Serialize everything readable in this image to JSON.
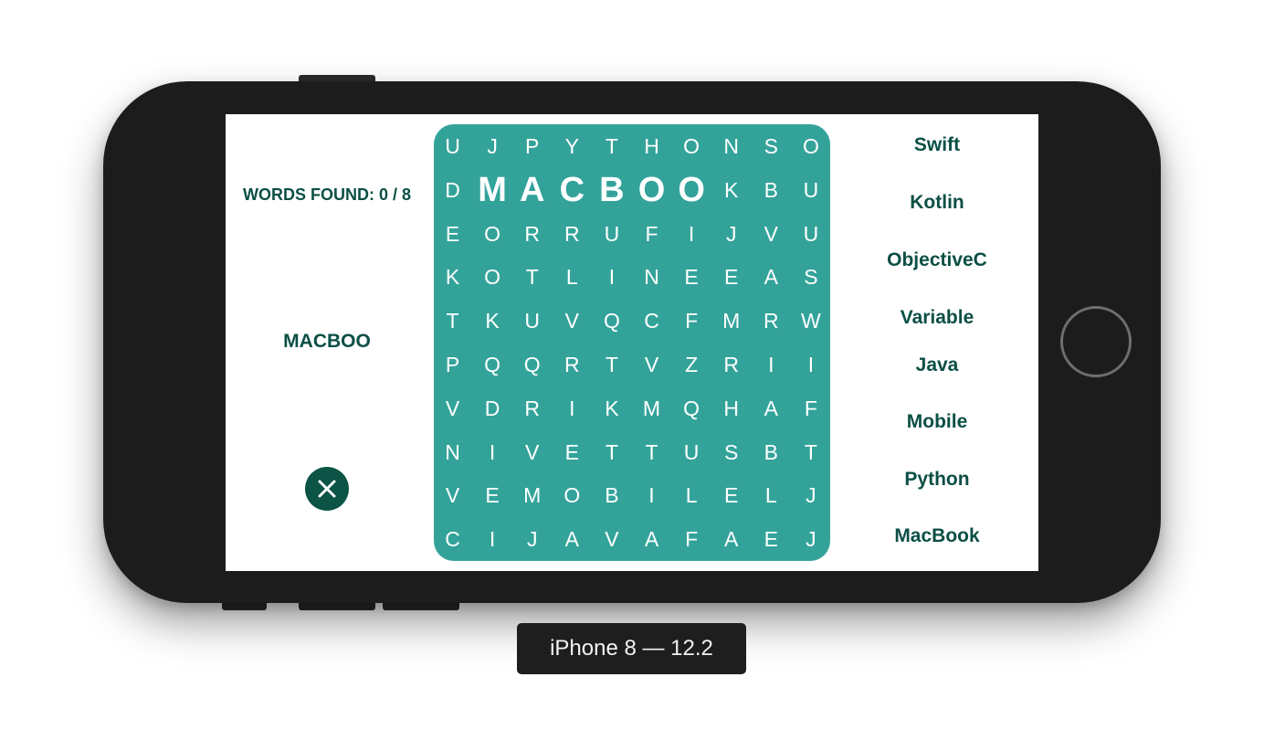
{
  "game": {
    "words_found": "WORDS FOUND: 0 / 8",
    "current_selection": "MACBOO",
    "close_icon": "close-icon"
  },
  "grid": {
    "rows": [
      [
        "U",
        "J",
        "P",
        "Y",
        "T",
        "H",
        "O",
        "N",
        "S",
        "O"
      ],
      [
        "D",
        "M",
        "A",
        "C",
        "B",
        "O",
        "O",
        "K",
        "B",
        "U"
      ],
      [
        "E",
        "O",
        "R",
        "R",
        "U",
        "F",
        "I",
        "J",
        "V",
        "U"
      ],
      [
        "K",
        "O",
        "T",
        "L",
        "I",
        "N",
        "E",
        "E",
        "A",
        "S"
      ],
      [
        "T",
        "K",
        "U",
        "V",
        "Q",
        "C",
        "F",
        "M",
        "R",
        "W"
      ],
      [
        "P",
        "Q",
        "Q",
        "R",
        "T",
        "V",
        "Z",
        "R",
        "I",
        "I"
      ],
      [
        "V",
        "D",
        "R",
        "I",
        "K",
        "M",
        "Q",
        "H",
        "A",
        "F"
      ],
      [
        "N",
        "I",
        "V",
        "E",
        "T",
        "T",
        "U",
        "S",
        "B",
        "T"
      ],
      [
        "V",
        "E",
        "M",
        "O",
        "B",
        "I",
        "L",
        "E",
        "L",
        "J"
      ],
      [
        "C",
        "I",
        "J",
        "A",
        "V",
        "A",
        "F",
        "A",
        "E",
        "J"
      ]
    ],
    "selected_cells": [
      [
        1,
        1
      ],
      [
        1,
        2
      ],
      [
        1,
        3
      ],
      [
        1,
        4
      ],
      [
        1,
        5
      ],
      [
        1,
        6
      ]
    ],
    "color": "#33a39a"
  },
  "word_list": [
    "Swift",
    "Kotlin",
    "ObjectiveC",
    "Variable",
    "Java",
    "Mobile",
    "Python",
    "MacBook"
  ],
  "device_label": "iPhone 8 — 12.2",
  "colors": {
    "accent_dark": "#0b4f45",
    "grid_bg": "#33a39a",
    "phone_body": "#1c1c1c"
  }
}
